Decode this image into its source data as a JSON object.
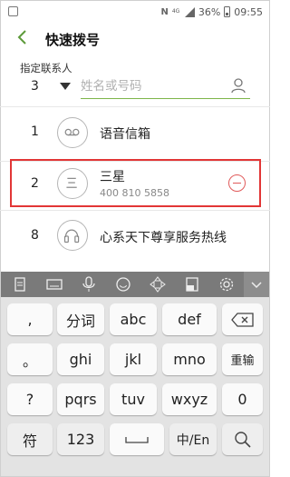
{
  "status": {
    "nfc": "N",
    "network": "4G",
    "battery": "36%",
    "time": "09:55"
  },
  "header": {
    "title": "快速拨号"
  },
  "assign": {
    "label": "指定联系人",
    "selected_number": "3",
    "search_placeholder": "姓名或号码"
  },
  "speed_dial": [
    {
      "number": "1",
      "name": "语音信箱",
      "icon": "voicemail-icon"
    },
    {
      "number": "2",
      "name": "三星",
      "phone": "400 810 5858",
      "icon": "san-contact-icon"
    },
    {
      "number": "8",
      "name": "心系天下尊享服务热线",
      "icon": "headset-icon"
    }
  ],
  "colors": {
    "accent": "#7eb64a",
    "highlight": "#e23636",
    "remove": "#e05a5a"
  },
  "keyboard": {
    "row1": [
      ",",
      "分词",
      "abc",
      "def",
      "⌫"
    ],
    "row2": [
      "。",
      "ghi",
      "jkl",
      "mno",
      "重输"
    ],
    "row3": [
      "?",
      "pqrs",
      "tuv",
      "wxyz",
      "0"
    ],
    "row4": [
      "符",
      "123",
      "␣",
      "中/En",
      "🔍"
    ]
  }
}
